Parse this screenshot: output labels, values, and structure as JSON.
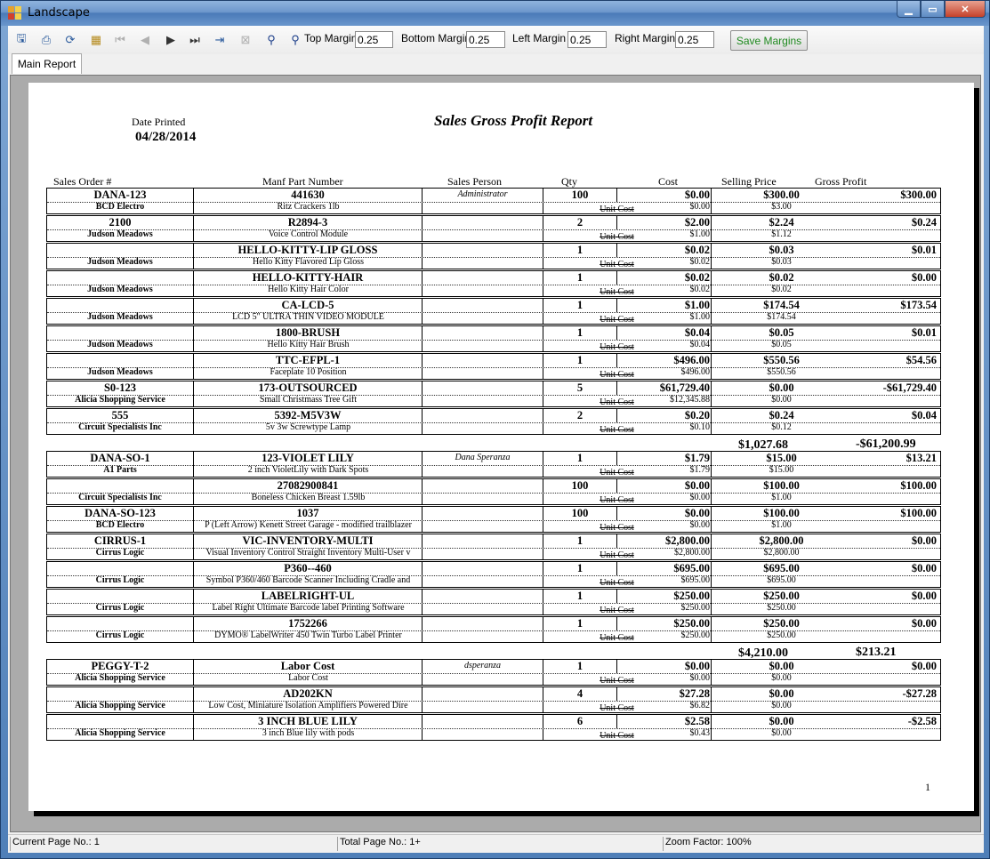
{
  "window": {
    "title": "Landscape"
  },
  "toolbar": {
    "icons": [
      "export-icon",
      "print-icon",
      "refresh-icon",
      "group-tree-icon",
      "first-page-icon",
      "prev-page-icon",
      "next-page-icon",
      "last-page-icon",
      "goto-page-icon",
      "stop-icon",
      "search-icon",
      "zoom-search-icon"
    ],
    "top_margin_label": "Top Margin",
    "top_margin_value": "0.25",
    "bottom_margin_label": "Bottom Margin",
    "bottom_margin_value": "0.25",
    "left_margin_label": "Left Margin",
    "left_margin_value": "0.25",
    "right_margin_label": "Right Margin",
    "right_margin_value": "0.25",
    "save_label": "Save Margins"
  },
  "tabs": [
    {
      "label": "Main Report"
    }
  ],
  "report": {
    "title": "Sales Gross Profit Report",
    "date_label": "Date Printed",
    "date_value": "04/28/2014",
    "headers": {
      "order": "Sales Order #",
      "part": "Manf Part Number",
      "person": "Sales Person",
      "qty": "Qty",
      "cost": "Cost",
      "price": "Selling Price",
      "profit": "Gross Profit"
    },
    "unit_cost_label": "Unit Cost",
    "groups": [
      {
        "rows": [
          {
            "order": "DANA-123",
            "customer": "BCD Electro",
            "part": "441630",
            "desc": "Ritz Crackers 1lb",
            "person": "Administrator",
            "qty": "100",
            "cost": "$0.00",
            "unit_cost": "$0.00",
            "price": "$300.00",
            "unit_price": "$3.00",
            "profit": "$300.00"
          },
          {
            "order": "2100",
            "customer": "Judson Meadows",
            "part": "R2894-3",
            "desc": "Voice Control Module",
            "person": "",
            "qty": "2",
            "cost": "$2.00",
            "unit_cost": "$1.00",
            "price": "$2.24",
            "unit_price": "$1.12",
            "profit": "$0.24"
          },
          {
            "order": "",
            "customer": "Judson Meadows",
            "part": "HELLO-KITTY-LIP GLOSS",
            "desc": "Hello Kitty Flavored Lip Gloss",
            "person": "",
            "qty": "1",
            "cost": "$0.02",
            "unit_cost": "$0.02",
            "price": "$0.03",
            "unit_price": "$0.03",
            "profit": "$0.01"
          },
          {
            "order": "",
            "customer": "Judson Meadows",
            "part": "HELLO-KITTY-HAIR",
            "desc": "Hello Kitty Hair Color",
            "person": "",
            "qty": "1",
            "cost": "$0.02",
            "unit_cost": "$0.02",
            "price": "$0.02",
            "unit_price": "$0.02",
            "profit": "$0.00"
          },
          {
            "order": "",
            "customer": "Judson Meadows",
            "part": "CA-LCD-5",
            "desc": "LCD 5\" ULTRA THIN VIDEO MODULE",
            "person": "",
            "qty": "1",
            "cost": "$1.00",
            "unit_cost": "$1.00",
            "price": "$174.54",
            "unit_price": "$174.54",
            "profit": "$173.54"
          },
          {
            "order": "",
            "customer": "Judson Meadows",
            "part": "1800-BRUSH",
            "desc": "Hello Kitty Hair Brush",
            "person": "",
            "qty": "1",
            "cost": "$0.04",
            "unit_cost": "$0.04",
            "price": "$0.05",
            "unit_price": "$0.05",
            "profit": "$0.01"
          },
          {
            "order": "",
            "customer": "Judson Meadows",
            "part": "TTC-EFPL-1",
            "desc": "Faceplate  10 Position",
            "person": "",
            "qty": "1",
            "cost": "$496.00",
            "unit_cost": "$496.00",
            "price": "$550.56",
            "unit_price": "$550.56",
            "profit": "$54.56"
          },
          {
            "order": "S0-123",
            "customer": "Alicia Shopping Service",
            "part": "173-OUTSOURCED",
            "desc": "Small Christmass Tree Gift",
            "person": "",
            "qty": "5",
            "cost": "$61,729.40",
            "unit_cost": "$12,345.88",
            "price": "$0.00",
            "unit_price": "$0.00",
            "profit": "-$61,729.40"
          },
          {
            "order": "555",
            "customer": "Circuit Specialists Inc",
            "part": "5392-M5V3W",
            "desc": "5v 3w Screwtype Lamp",
            "person": "",
            "qty": "2",
            "cost": "$0.20",
            "unit_cost": "$0.10",
            "price": "$0.24",
            "unit_price": "$0.12",
            "profit": "$0.04"
          }
        ],
        "total_price": "$1,027.68",
        "total_profit": "-$61,200.99"
      },
      {
        "rows": [
          {
            "order": "DANA-SO-1",
            "customer": "A1 Parts",
            "part": "123-VIOLET LILY",
            "desc": "2 inch VioletLily with Dark Spots",
            "person": "Dana Speranza",
            "qty": "1",
            "cost": "$1.79",
            "unit_cost": "$1.79",
            "price": "$15.00",
            "unit_price": "$15.00",
            "profit": "$13.21"
          },
          {
            "order": "",
            "customer": "Circuit Specialists Inc",
            "part": "27082900841",
            "desc": "Boneless Chicken Breast 1.59lb",
            "person": "",
            "qty": "100",
            "cost": "$0.00",
            "unit_cost": "$0.00",
            "price": "$100.00",
            "unit_price": "$1.00",
            "profit": "$100.00"
          },
          {
            "order": "DANA-SO-123",
            "customer": "BCD Electro",
            "part": "1037",
            "desc": "P (Left Arrow) Kenett Street Garage - modified trailblazer",
            "person": "",
            "qty": "100",
            "cost": "$0.00",
            "unit_cost": "$0.00",
            "price": "$100.00",
            "unit_price": "$1.00",
            "profit": "$100.00"
          },
          {
            "order": "CIRRUS-1",
            "customer": "Cirrus Logic",
            "part": "VIC-INVENTORY-MULTI",
            "desc": "Visual Inventory Control Straight Inventory Multi-User v",
            "person": "",
            "qty": "1",
            "cost": "$2,800.00",
            "unit_cost": "$2,800.00",
            "price": "$2,800.00",
            "unit_price": "$2,800.00",
            "profit": "$0.00"
          },
          {
            "order": "",
            "customer": "Cirrus Logic",
            "part": "P360--460",
            "desc": "Symbol P360/460 Barcode Scanner Including Cradle and",
            "person": "",
            "qty": "1",
            "cost": "$695.00",
            "unit_cost": "$695.00",
            "price": "$695.00",
            "unit_price": "$695.00",
            "profit": "$0.00"
          },
          {
            "order": "",
            "customer": "Cirrus Logic",
            "part": "LABELRIGHT-UL",
            "desc": "Label Right Ultimate Barcode label Printing Software",
            "person": "",
            "qty": "1",
            "cost": "$250.00",
            "unit_cost": "$250.00",
            "price": "$250.00",
            "unit_price": "$250.00",
            "profit": "$0.00"
          },
          {
            "order": "",
            "customer": "Cirrus Logic",
            "part": "1752266",
            "desc": "DYMO® LabelWriter 450 Twin Turbo Label Printer",
            "person": "",
            "qty": "1",
            "cost": "$250.00",
            "unit_cost": "$250.00",
            "price": "$250.00",
            "unit_price": "$250.00",
            "profit": "$0.00"
          }
        ],
        "total_price": "$4,210.00",
        "total_profit": "$213.21"
      },
      {
        "rows": [
          {
            "order": "PEGGY-T-2",
            "customer": "Alicia Shopping Service",
            "part": "Labor Cost",
            "desc": "Labor Cost",
            "person": "dsperanza",
            "qty": "1",
            "cost": "$0.00",
            "unit_cost": "$0.00",
            "price": "$0.00",
            "unit_price": "$0.00",
            "profit": "$0.00"
          },
          {
            "order": "",
            "customer": "Alicia Shopping Service",
            "part": "AD202KN",
            "desc": "Low Cost, Miniature Isolation Amplifiers Powered Dire",
            "person": "",
            "qty": "4",
            "cost": "$27.28",
            "unit_cost": "$6.82",
            "price": "$0.00",
            "unit_price": "$0.00",
            "profit": "-$27.28"
          },
          {
            "order": "",
            "customer": "Alicia Shopping Service",
            "part": "3 INCH BLUE LILY",
            "desc": "3 inch Blue lily with pods",
            "person": "",
            "qty": "6",
            "cost": "$2.58",
            "unit_cost": "$0.43",
            "price": "$0.00",
            "unit_price": "$0.00",
            "profit": "-$2.58"
          }
        ]
      }
    ],
    "page_number": "1"
  },
  "status": {
    "current_page": "Current Page No.: 1",
    "total_page": "Total Page No.: 1+",
    "zoom": "Zoom Factor: 100%"
  }
}
